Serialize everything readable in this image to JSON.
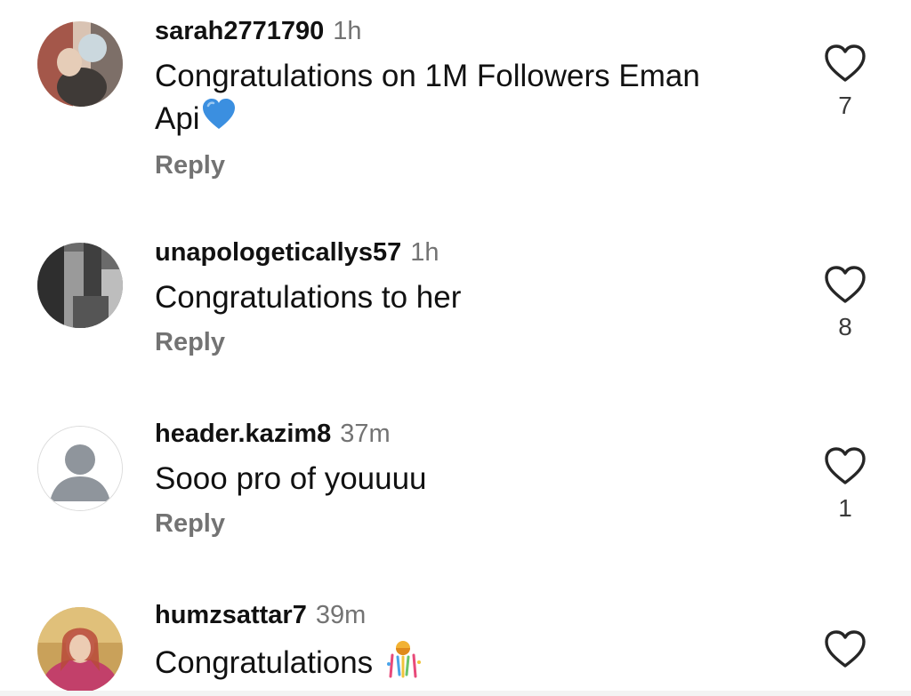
{
  "comments": [
    {
      "username": "sarah2771790",
      "time": "1h",
      "text": "Congratulations on 1M Followers Eman",
      "text_line2": "Api",
      "emoji": "blue-heart",
      "reply_label": "Reply",
      "likes": "7"
    },
    {
      "username": "unapologeticallys57",
      "time": "1h",
      "text": "Congratulations to her",
      "reply_label": "Reply",
      "likes": "8"
    },
    {
      "username": "header.kazim8",
      "time": "37m",
      "text": "Sooo pro of youuuu",
      "reply_label": "Reply",
      "likes": "1"
    },
    {
      "username": "humzsattar7",
      "time": "39m",
      "text": "Congratulations",
      "emoji": "confetti-ball",
      "likes": ""
    }
  ],
  "colors": {
    "text": "#111111",
    "muted": "#737373",
    "blue_heart": "#3b8fe0"
  },
  "icons": {
    "like": "heart-outline-icon",
    "default_avatar": "person-icon"
  }
}
